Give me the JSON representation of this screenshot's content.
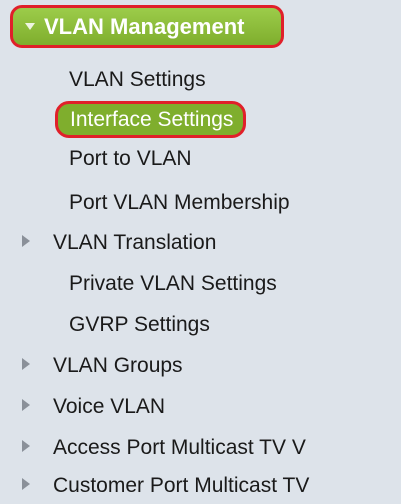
{
  "nav": {
    "section_title": "VLAN Management",
    "items": [
      {
        "label": "VLAN Settings",
        "type": "link"
      },
      {
        "label": "Interface Settings",
        "type": "link",
        "selected": true
      },
      {
        "label": "Port to VLAN",
        "type": "link"
      },
      {
        "label": "Port VLAN Membership",
        "type": "link"
      },
      {
        "label": "VLAN Translation",
        "type": "folder"
      },
      {
        "label": "Private VLAN Settings",
        "type": "link"
      },
      {
        "label": "GVRP Settings",
        "type": "link"
      },
      {
        "label": "VLAN Groups",
        "type": "folder"
      },
      {
        "label": "Voice VLAN",
        "type": "folder"
      },
      {
        "label": "Access Port Multicast TV V",
        "type": "folder"
      },
      {
        "label": "Customer Port Multicast TV",
        "type": "folder"
      }
    ]
  },
  "colors": {
    "header_green": "#8fbd3e",
    "selected_green": "#7fae2d",
    "callout_red": "#e0202a",
    "panel_bg": "#dde3ea"
  },
  "icons": {
    "section_expanded": "caret-down-icon",
    "folder_collapsed": "triangle-right-icon"
  }
}
